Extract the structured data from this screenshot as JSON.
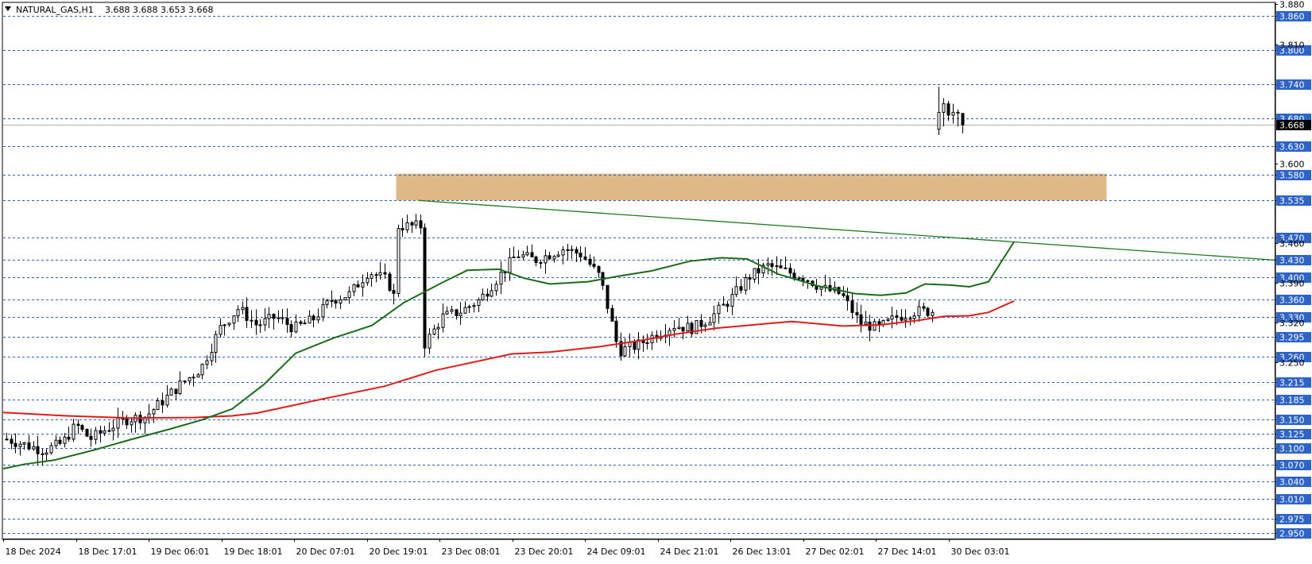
{
  "header": {
    "symbol": "NATURAL_GAS,H1",
    "ohlc": "3.688 3.688 3.653 3.668"
  },
  "colors": {
    "background": "#ffffff",
    "candle": "#000000",
    "grid": "#2f5fb8",
    "label_bg": "#2e63c8",
    "ma_fast": "#1c6b1c",
    "ma_slow": "#e01b1b",
    "trendline": "#1f7a1f",
    "zone": "#deb887"
  },
  "chart_data": {
    "type": "candlestick",
    "title": "NATURAL_GAS,H1",
    "ylim": [
      2.94,
      3.882
    ],
    "right_axis_ticks": [
      "3.880",
      "3.810",
      "3.600",
      "3.460",
      "3.390",
      "3.320",
      "3.250"
    ],
    "horizontal_levels": [
      3.86,
      3.8,
      3.74,
      3.68,
      3.63,
      3.58,
      3.535,
      3.47,
      3.43,
      3.4,
      3.36,
      3.33,
      3.295,
      3.26,
      3.215,
      3.185,
      3.15,
      3.125,
      3.1,
      3.07,
      3.04,
      3.01,
      2.975,
      2.95
    ],
    "horizontal_level_labels": [
      "3.860",
      "3.800",
      "3.740",
      "3.680",
      "3.630",
      "3.580",
      "3.535",
      "3.470",
      "3.430",
      "3.400",
      "3.360",
      "3.330",
      "3.295",
      "3.260",
      "3.215",
      "3.185",
      "3.150",
      "3.125",
      "3.100",
      "3.070",
      "3.040",
      "3.010",
      "2.975",
      "2.950"
    ],
    "current_price": 3.668,
    "current_price_label": "3.668",
    "x_labels": [
      "18 Dec 2024",
      "18 Dec 17:01",
      "19 Dec 06:01",
      "19 Dec 18:01",
      "20 Dec 07:01",
      "20 Dec 19:01",
      "23 Dec 08:01",
      "23 Dec 20:01",
      "24 Dec 09:01",
      "24 Dec 21:01",
      "26 Dec 13:01",
      "27 Dec 02:01",
      "27 Dec 14:01",
      "30 Dec 03:01"
    ],
    "resistance_zone": {
      "y_from": 3.535,
      "y_to": 3.582,
      "x_from": "20 Dec 19:01",
      "x_to": "30 Dec 03:01"
    },
    "trendline": {
      "start": {
        "bar": 0.42,
        "price": 3.535
      },
      "end": {
        "bar": 1.0,
        "price": 3.43
      }
    },
    "ma_fast_series": [
      [
        0,
        3.063
      ],
      [
        0.017,
        3.071
      ],
      [
        0.04,
        3.078
      ],
      [
        0.07,
        3.095
      ],
      [
        0.1,
        3.114
      ],
      [
        0.13,
        3.132
      ],
      [
        0.155,
        3.148
      ],
      [
        0.18,
        3.168
      ],
      [
        0.205,
        3.211
      ],
      [
        0.23,
        3.266
      ],
      [
        0.26,
        3.293
      ],
      [
        0.29,
        3.315
      ],
      [
        0.315,
        3.355
      ],
      [
        0.345,
        3.39
      ],
      [
        0.365,
        3.412
      ],
      [
        0.39,
        3.414
      ],
      [
        0.41,
        3.398
      ],
      [
        0.43,
        3.388
      ],
      [
        0.46,
        3.392
      ],
      [
        0.485,
        3.402
      ],
      [
        0.51,
        3.411
      ],
      [
        0.54,
        3.428
      ],
      [
        0.565,
        3.434
      ],
      [
        0.585,
        3.432
      ],
      [
        0.61,
        3.405
      ],
      [
        0.64,
        3.385
      ],
      [
        0.67,
        3.371
      ],
      [
        0.69,
        3.368
      ],
      [
        0.71,
        3.372
      ],
      [
        0.725,
        3.388
      ],
      [
        0.745,
        3.386
      ],
      [
        0.76,
        3.383
      ],
      [
        0.775,
        3.392
      ],
      [
        0.795,
        3.462
      ]
    ],
    "ma_slow_series": [
      [
        0,
        3.162
      ],
      [
        0.05,
        3.156
      ],
      [
        0.1,
        3.152
      ],
      [
        0.15,
        3.153
      ],
      [
        0.18,
        3.156
      ],
      [
        0.2,
        3.161
      ],
      [
        0.25,
        3.185
      ],
      [
        0.3,
        3.208
      ],
      [
        0.34,
        3.236
      ],
      [
        0.4,
        3.265
      ],
      [
        0.43,
        3.268
      ],
      [
        0.47,
        3.278
      ],
      [
        0.5,
        3.288
      ],
      [
        0.53,
        3.3
      ],
      [
        0.56,
        3.31
      ],
      [
        0.6,
        3.318
      ],
      [
        0.62,
        3.322
      ],
      [
        0.64,
        3.318
      ],
      [
        0.66,
        3.314
      ],
      [
        0.69,
        3.316
      ],
      [
        0.72,
        3.324
      ],
      [
        0.74,
        3.331
      ],
      [
        0.76,
        3.332
      ],
      [
        0.775,
        3.338
      ],
      [
        0.795,
        3.358
      ]
    ]
  }
}
